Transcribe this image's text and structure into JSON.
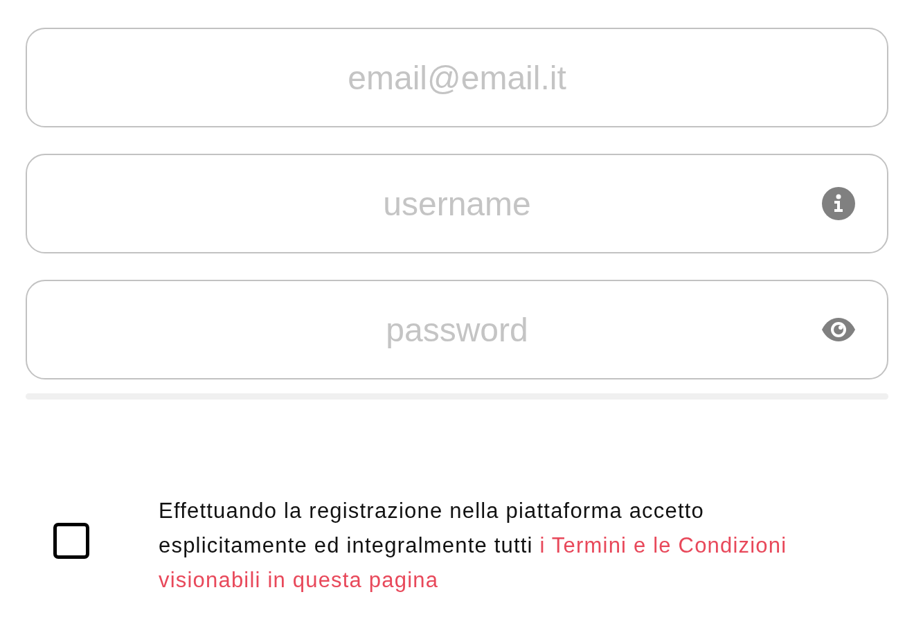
{
  "fields": [
    {
      "placeholder": "email@email.it",
      "kind": "plain"
    },
    {
      "placeholder": "username",
      "kind": "info"
    },
    {
      "placeholder": "password",
      "kind": "secret"
    }
  ],
  "terms": {
    "checked": false,
    "text": "Effettuando la registrazione nella piattaforma accetto esplicitamente ed integralmente tutti",
    "link_lines": [
      "i Termini e le Condizioni",
      "visionabili in questa pagina"
    ]
  }
}
